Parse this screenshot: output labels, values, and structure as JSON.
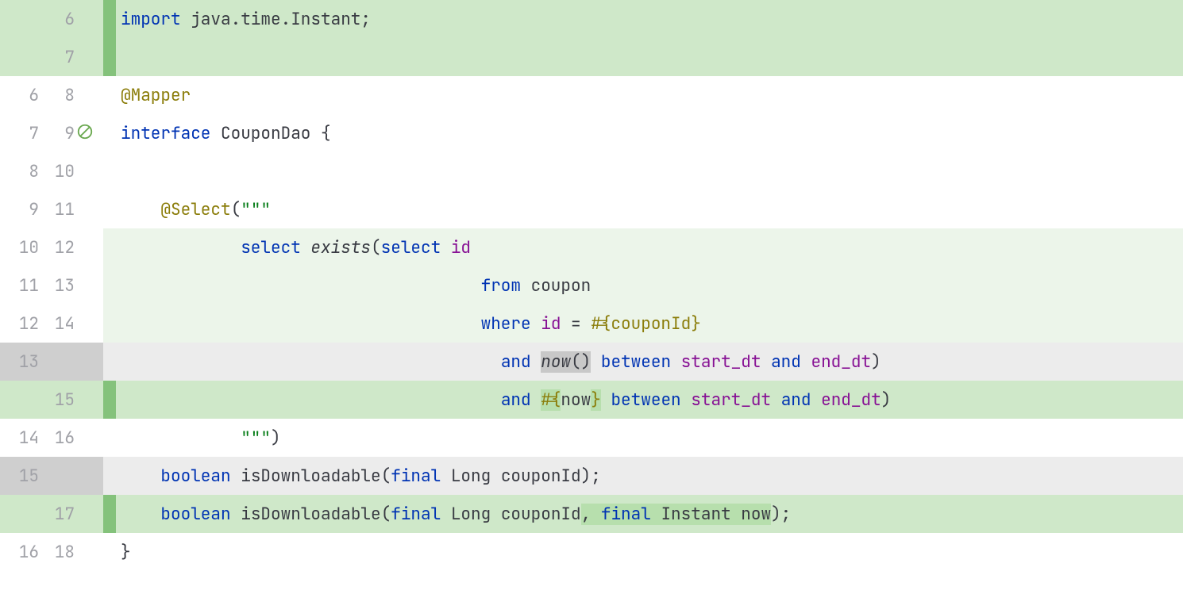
{
  "rows": [
    {
      "old": "",
      "new": "6",
      "type": "added",
      "tokens": [
        {
          "cls": "kw",
          "t": "import "
        },
        {
          "cls": "plain",
          "t": "java.time.Instant;"
        }
      ]
    },
    {
      "old": "",
      "new": "7",
      "type": "added",
      "tokens": [
        {
          "cls": "plain",
          "t": ""
        }
      ]
    },
    {
      "old": "6",
      "new": "8",
      "type": "ctx",
      "tokens": [
        {
          "cls": "ann",
          "t": "@Mapper"
        }
      ]
    },
    {
      "old": "7",
      "new": "9",
      "type": "ctx",
      "icon": "no-comments",
      "tokens": [
        {
          "cls": "kw",
          "t": "interface "
        },
        {
          "cls": "plain",
          "t": "CouponDao {"
        }
      ]
    },
    {
      "old": "8",
      "new": "10",
      "type": "ctx",
      "tokens": [
        {
          "cls": "plain",
          "t": ""
        }
      ]
    },
    {
      "old": "9",
      "new": "11",
      "type": "ctx",
      "tokens": [
        {
          "cls": "plain",
          "t": "    "
        },
        {
          "cls": "ann",
          "t": "@Select"
        },
        {
          "cls": "plain",
          "t": "("
        },
        {
          "cls": "str",
          "t": "\"\"\""
        }
      ]
    },
    {
      "old": "10",
      "new": "12",
      "type": "ctx-light",
      "tokens": [
        {
          "cls": "str",
          "t": "            "
        },
        {
          "cls": "sqlkw",
          "t": "select "
        },
        {
          "cls": "sqlfn",
          "t": "exists"
        },
        {
          "cls": "plain",
          "t": "("
        },
        {
          "cls": "sqlkw",
          "t": "select "
        },
        {
          "cls": "ident",
          "t": "id"
        }
      ]
    },
    {
      "old": "11",
      "new": "13",
      "type": "ctx-light",
      "tokens": [
        {
          "cls": "str",
          "t": "                                    "
        },
        {
          "cls": "sqlkw",
          "t": "from "
        },
        {
          "cls": "plain",
          "t": "coupon"
        }
      ]
    },
    {
      "old": "12",
      "new": "14",
      "type": "ctx-light",
      "tokens": [
        {
          "cls": "str",
          "t": "                                    "
        },
        {
          "cls": "sqlkw",
          "t": "where "
        },
        {
          "cls": "ident",
          "t": "id"
        },
        {
          "cls": "plain",
          "t": " = "
        },
        {
          "cls": "ann",
          "t": "#{couponId}"
        }
      ]
    },
    {
      "old": "13",
      "new": "",
      "type": "del",
      "tokens": [
        {
          "cls": "str",
          "t": "                                      "
        },
        {
          "cls": "sqlkw",
          "t": "and "
        },
        {
          "seg": "del",
          "cls": "sqlfn",
          "t": "now"
        },
        {
          "seg": "del",
          "cls": "plain",
          "t": "()"
        },
        {
          "cls": "plain",
          "t": " "
        },
        {
          "cls": "sqlkw",
          "t": "between "
        },
        {
          "cls": "ident",
          "t": "start_dt"
        },
        {
          "cls": "plain",
          "t": " "
        },
        {
          "cls": "sqlkw",
          "t": "and "
        },
        {
          "cls": "ident",
          "t": "end_dt"
        },
        {
          "cls": "plain",
          "t": ")"
        }
      ]
    },
    {
      "old": "",
      "new": "15",
      "type": "added-inline",
      "tokens": [
        {
          "cls": "str",
          "t": "                                      "
        },
        {
          "cls": "sqlkw",
          "t": "and "
        },
        {
          "seg": "add",
          "cls": "ann",
          "t": "#{"
        },
        {
          "cls": "plain",
          "t": "now"
        },
        {
          "seg": "add",
          "cls": "ann",
          "t": "}"
        },
        {
          "cls": "plain",
          "t": " "
        },
        {
          "cls": "sqlkw",
          "t": "between "
        },
        {
          "cls": "ident",
          "t": "start_dt"
        },
        {
          "cls": "plain",
          "t": " "
        },
        {
          "cls": "sqlkw",
          "t": "and "
        },
        {
          "cls": "ident",
          "t": "end_dt"
        },
        {
          "cls": "plain",
          "t": ")"
        }
      ]
    },
    {
      "old": "14",
      "new": "16",
      "type": "ctx",
      "tokens": [
        {
          "cls": "str",
          "t": "            \"\"\""
        },
        {
          "cls": "plain",
          "t": ")"
        }
      ]
    },
    {
      "old": "15",
      "new": "",
      "type": "del",
      "tokens": [
        {
          "cls": "plain",
          "t": "    "
        },
        {
          "cls": "kw",
          "t": "boolean "
        },
        {
          "cls": "plain",
          "t": "isDownloadable("
        },
        {
          "cls": "kw",
          "t": "final "
        },
        {
          "cls": "plain",
          "t": "Long couponId);"
        }
      ]
    },
    {
      "old": "",
      "new": "17",
      "type": "added-inline",
      "tokens": [
        {
          "cls": "plain",
          "t": "    "
        },
        {
          "cls": "kw",
          "t": "boolean "
        },
        {
          "cls": "plain",
          "t": "isDownloadable("
        },
        {
          "cls": "kw",
          "t": "final "
        },
        {
          "cls": "plain",
          "t": "Long couponId"
        },
        {
          "seg": "add",
          "cls": "plain",
          "t": ", "
        },
        {
          "seg": "add",
          "cls": "kw",
          "t": "final "
        },
        {
          "seg": "add",
          "cls": "plain",
          "t": "Instant now"
        },
        {
          "cls": "plain",
          "t": ");"
        }
      ]
    },
    {
      "old": "16",
      "new": "18",
      "type": "ctx",
      "tokens": [
        {
          "cls": "plain",
          "t": "}"
        }
      ]
    }
  ]
}
